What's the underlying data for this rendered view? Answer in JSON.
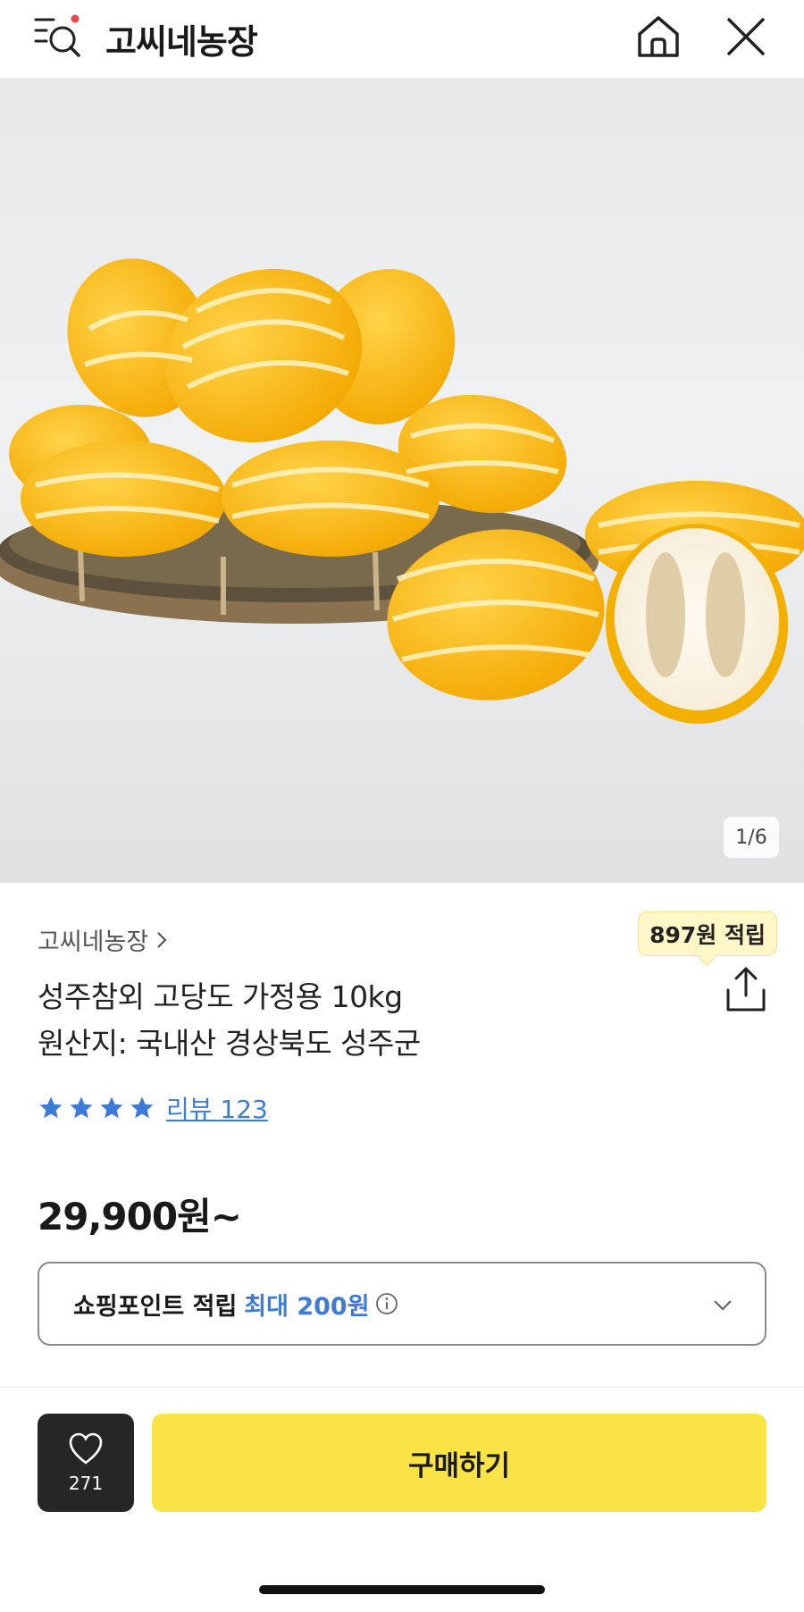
{
  "header": {
    "title": "고씨네농장",
    "icons": {
      "menu_search": "menu-search-icon",
      "home": "home-icon",
      "close": "close-icon"
    },
    "accent_dot_color": "#e94b4b"
  },
  "gallery": {
    "page_indicator": "1/6"
  },
  "product": {
    "store_link": "고씨네농장",
    "point_badge": "897원 적립",
    "name_line1": "성주참외 고당도 가정용 10kg",
    "name_line2": "원산지: 국내산 경상북도 성주군",
    "rating_stars": 4,
    "review_link": "리뷰 123",
    "price": "29,900원~"
  },
  "points_box": {
    "label": "쇼핑포인트 적립",
    "max": "최대 200원"
  },
  "bottom_bar": {
    "like_count": "271",
    "buy_label": "구매하기"
  },
  "colors": {
    "buy_button": "#fae345",
    "like_button": "#262626",
    "link_blue": "#3d7bd9",
    "badge_bg": "#fff7c8"
  }
}
